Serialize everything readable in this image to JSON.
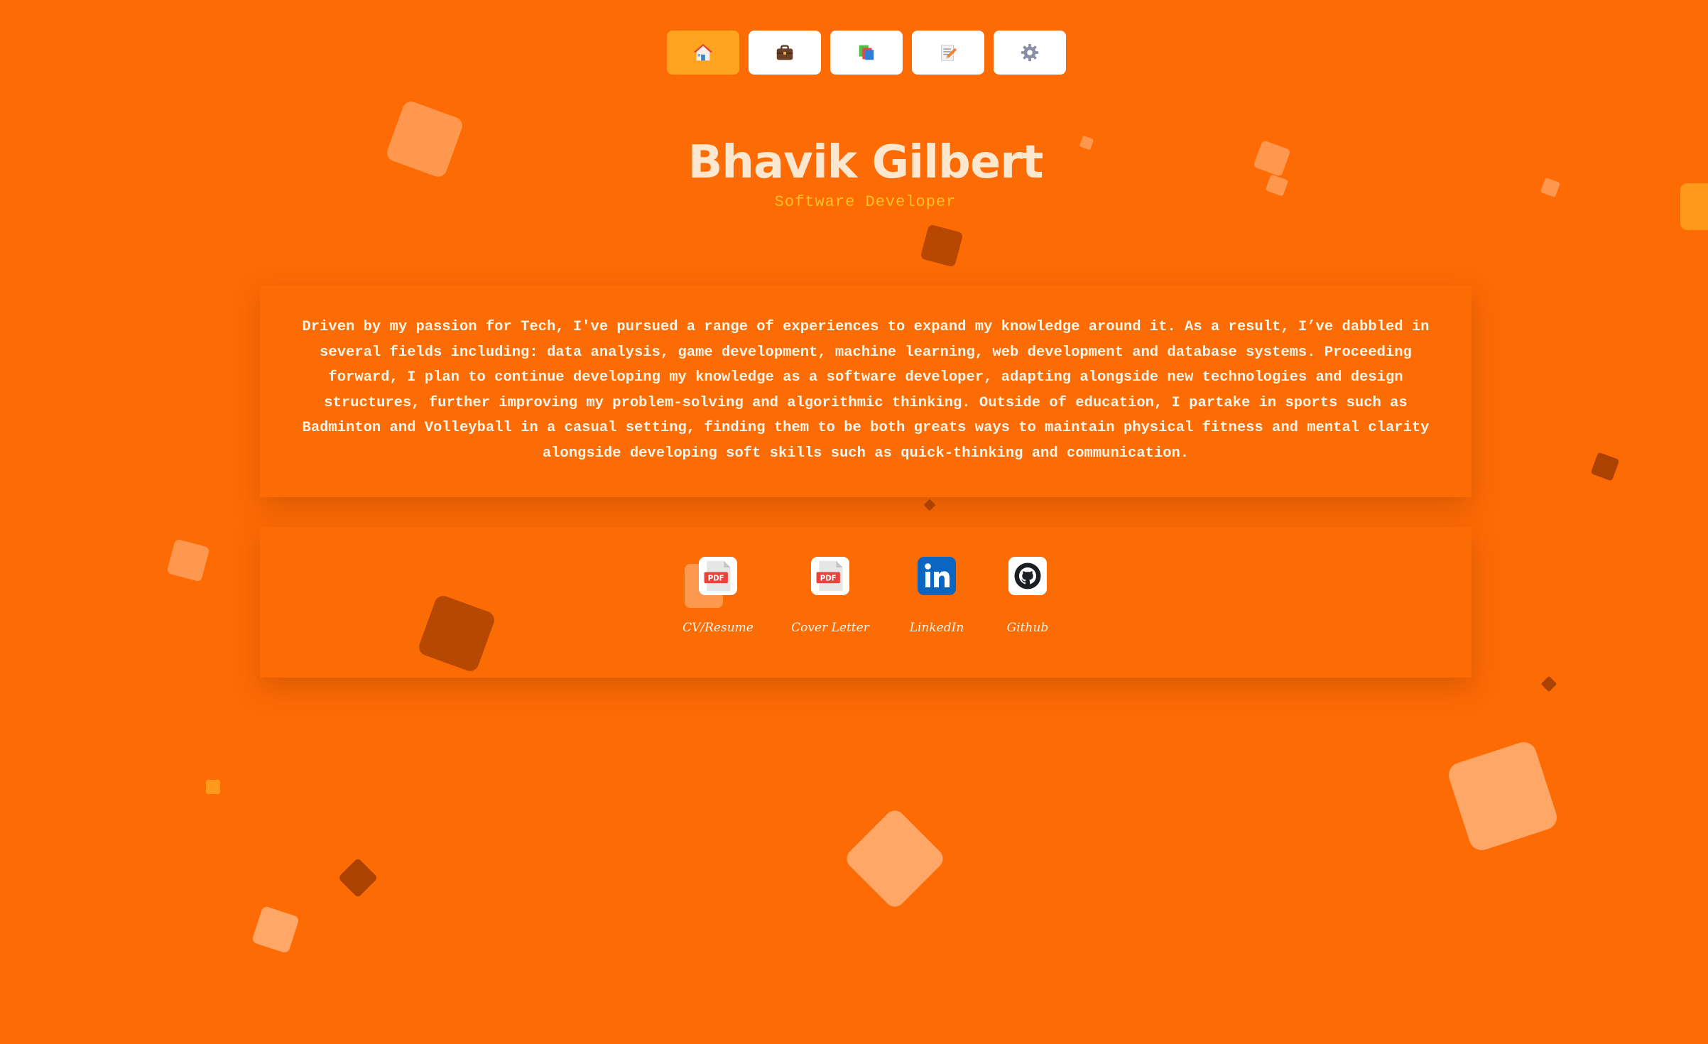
{
  "nav": {
    "buttons": [
      {
        "name": "home",
        "icon": "house-icon",
        "active": true
      },
      {
        "name": "projects",
        "icon": "briefcase-icon",
        "active": false
      },
      {
        "name": "gallery",
        "icon": "stacked-pages-icon",
        "active": false
      },
      {
        "name": "blog",
        "icon": "memo-icon",
        "active": false
      },
      {
        "name": "settings",
        "icon": "gear-icon",
        "active": false
      }
    ]
  },
  "header": {
    "name": "Bhavik Gilbert",
    "role": "Software Developer"
  },
  "about": {
    "text": "Driven by my passion for Tech, I've pursued a range of experiences to expand my knowledge around it. As a result, I’ve dabbled in several fields including: data analysis, game development, machine learning, web development and database systems. Proceeding forward, I plan to continue developing my knowledge as a software developer, adapting alongside new technologies and design structures, further improving my problem-solving and algorithmic thinking.  Outside of education, I partake in sports such as Badminton and Volleyball in a casual setting, finding them to be both greats ways to maintain physical fitness and mental clarity alongside developing soft skills such as quick-thinking and communication."
  },
  "links": [
    {
      "label": "CV/Resume",
      "icon": "pdf-icon"
    },
    {
      "label": "Cover Letter",
      "icon": "pdf-icon"
    },
    {
      "label": "LinkedIn",
      "icon": "linkedin-icon"
    },
    {
      "label": "Github",
      "icon": "github-icon"
    }
  ],
  "colors": {
    "background": "#fd6b05",
    "active_nav": "#ffa41c",
    "title": "#fde7cf",
    "subtitle": "#ffc02a",
    "text": "#fff4e8"
  }
}
